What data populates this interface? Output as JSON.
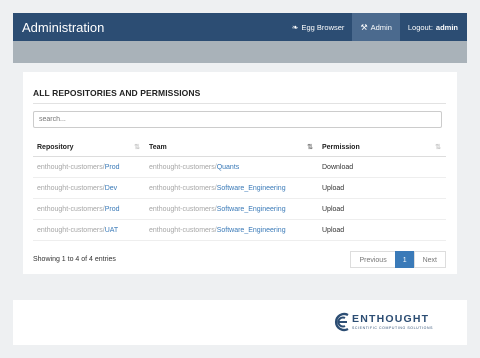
{
  "navbar": {
    "title": "Administration",
    "egg_browser_label": "Egg Browser",
    "admin_label": "Admin",
    "logout_label": "Logout:",
    "logout_user": "admin"
  },
  "panel": {
    "title": "ALL REPOSITORIES AND PERMISSIONS",
    "search_placeholder": "search...",
    "columns": [
      "Repository",
      "Team",
      "Permission"
    ],
    "rows": [
      {
        "repo_prefix": "enthought-customers/",
        "repo": "Prod",
        "team_prefix": "enthought-customers/",
        "team": "Quants",
        "permission": "Download"
      },
      {
        "repo_prefix": "enthought-customers/",
        "repo": "Dev",
        "team_prefix": "enthought-customers/",
        "team": "Software_Engineering",
        "permission": "Upload"
      },
      {
        "repo_prefix": "enthought-customers/",
        "repo": "Prod",
        "team_prefix": "enthought-customers/",
        "team": "Software_Engineering",
        "permission": "Upload"
      },
      {
        "repo_prefix": "enthought-customers/",
        "repo": "UAT",
        "team_prefix": "enthought-customers/",
        "team": "Software_Engineering",
        "permission": "Upload"
      }
    ],
    "info": "Showing 1 to 4 of 4 entries",
    "pagination": {
      "previous": "Previous",
      "current": "1",
      "next": "Next"
    }
  },
  "logo": {
    "word": "ENTHOUGHT",
    "tagline": "SCIENTIFIC COMPUTING SOLUTIONS"
  },
  "colors": {
    "navbar": "#2c4d73",
    "active_nav": "#4b6a8e",
    "link": "#3a7ab8",
    "band": "#a9b2b9"
  }
}
